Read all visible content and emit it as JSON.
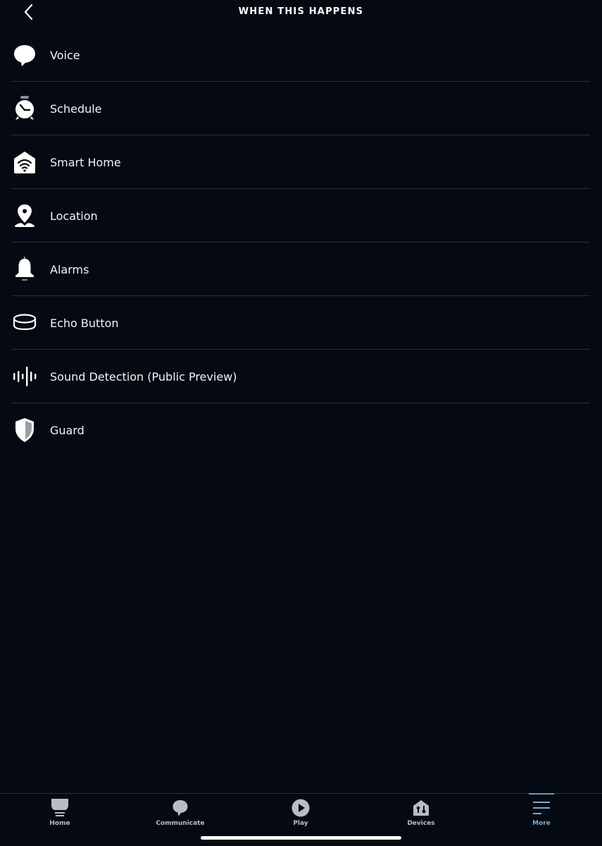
{
  "header": {
    "title": "WHEN THIS HAPPENS",
    "back_icon": "chevron-left-icon"
  },
  "triggers": [
    {
      "label": "Voice",
      "icon": "speech-bubble-icon"
    },
    {
      "label": "Schedule",
      "icon": "alarm-clock-icon"
    },
    {
      "label": "Smart Home",
      "icon": "smart-home-icon"
    },
    {
      "label": "Location",
      "icon": "location-pin-icon"
    },
    {
      "label": "Alarms",
      "icon": "bell-icon"
    },
    {
      "label": "Echo Button",
      "icon": "echo-button-icon"
    },
    {
      "label": "Sound Detection (Public Preview)",
      "icon": "sound-wave-icon"
    },
    {
      "label": "Guard",
      "icon": "shield-icon"
    }
  ],
  "tabbar": {
    "active": "More",
    "tabs": [
      {
        "label": "Home",
        "icon": "home-icon"
      },
      {
        "label": "Communicate",
        "icon": "speech-bubble-icon"
      },
      {
        "label": "Play",
        "icon": "play-icon"
      },
      {
        "label": "Devices",
        "icon": "devices-icon"
      },
      {
        "label": "More",
        "icon": "menu-icon"
      }
    ]
  },
  "colors": {
    "background": "#050a12",
    "divider": "#2a303a",
    "tab_inactive": "#b9bcc2",
    "tab_active": "#7fa9cc"
  }
}
